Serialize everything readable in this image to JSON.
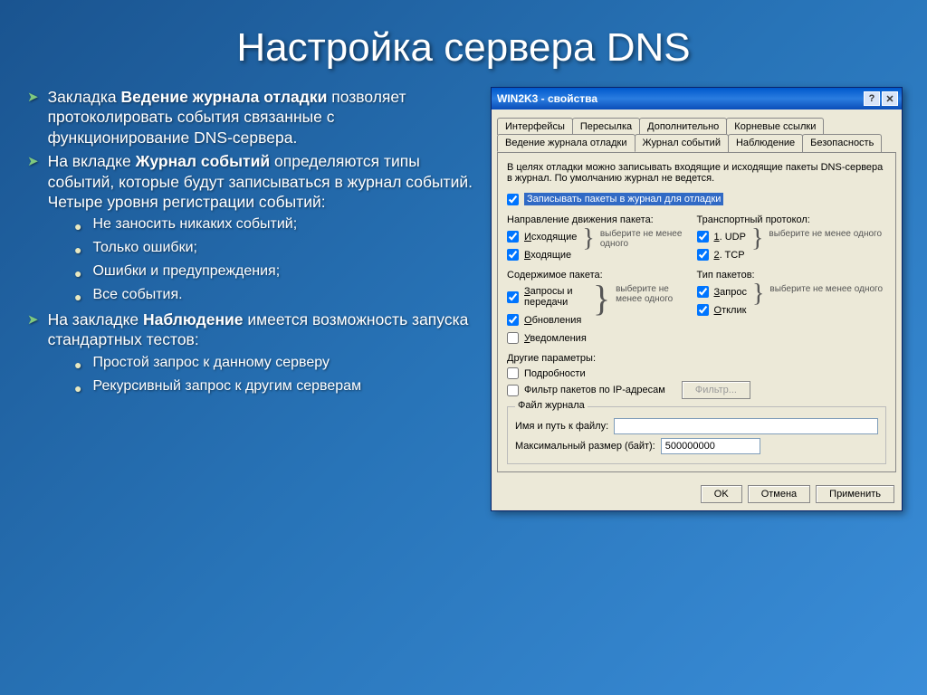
{
  "slide": {
    "title": "Настройка сервера DNS",
    "bullets": [
      {
        "prefix": "Закладка ",
        "bold": "Ведение журнала отладки",
        "suffix": " позволяет протоколировать события связанные с функционирование DNS-сервера."
      },
      {
        "prefix": "На вкладке ",
        "bold": "Журнал событий",
        "suffix": " определяются типы событий, которые будут записываться в журнал событий. Четыре уровня регистрации событий:",
        "sub": [
          "Не заносить никаких событий;",
          "Только ошибки;",
          "Ошибки и предупреждения;",
          "Все события."
        ]
      },
      {
        "prefix": "На закладке ",
        "bold": "Наблюдение",
        "suffix": " имеется возможность запуска стандартных тестов:",
        "sub": [
          "Простой запрос  к данному серверу",
          "Рекурсивный запрос к другим серверам"
        ]
      }
    ]
  },
  "dialog": {
    "title": "WIN2K3 - свойства",
    "tabs_row1": [
      "Интерфейсы",
      "Пересылка",
      "Дополнительно",
      "Корневые ссылки"
    ],
    "tabs_row2": [
      "Ведение журнала отладки",
      "Журнал событий",
      "Наблюдение",
      "Безопасность"
    ],
    "active_tab": "Ведение журнала отладки",
    "desc": "В целях отладки можно записывать входящие и исходящие пакеты DNS-сервера в журнал. По умолчанию журнал не ведется.",
    "main_chk": "Записывать пакеты в журнал для отладки",
    "group_direction": {
      "label": "Направление движения пакета:",
      "items": [
        "Исходящие",
        "Входящие"
      ]
    },
    "group_transport": {
      "label": "Транспортный протокол:",
      "items": [
        "1. UDP",
        "2. TCP"
      ]
    },
    "group_content": {
      "label": "Содержимое пакета:",
      "items": [
        "Запросы и передачи",
        "Обновления",
        "Уведомления"
      ]
    },
    "group_type": {
      "label": "Тип пакетов:",
      "items": [
        "Запрос",
        "Отклик"
      ]
    },
    "brace_text": "выберите не менее одного",
    "other_params": {
      "label": "Другие параметры:",
      "items": [
        "Подробности",
        "Фильтр пакетов по IP-адресам"
      ]
    },
    "filter_btn": "Фильтр...",
    "file_group": {
      "legend": "Файл журнала",
      "path_label": "Имя и путь к файлу:",
      "path_value": "",
      "size_label": "Максимальный размер (байт):",
      "size_value": "500000000"
    },
    "buttons": {
      "ok": "OK",
      "cancel": "Отмена",
      "apply": "Применить"
    }
  }
}
